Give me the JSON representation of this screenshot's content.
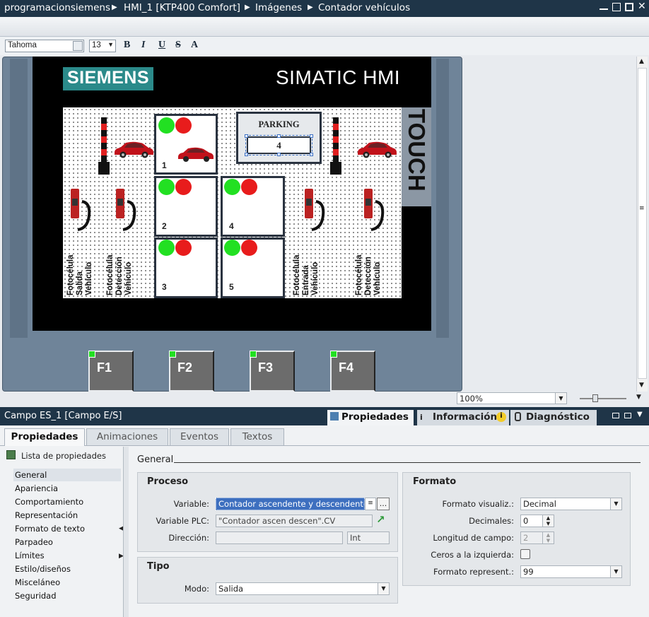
{
  "titlebar": {
    "crumbs": [
      "programacionsiemens",
      "HMI_1 [KTP400 Comfort]",
      "Imágenes",
      "Contador vehículos"
    ]
  },
  "toolbar": {
    "font": "Tahoma",
    "size": "13",
    "bold": "B",
    "italic": "I",
    "underline": "U",
    "strike": "S",
    "superscript": "A"
  },
  "hmi": {
    "brand": "SIEMENS",
    "product": "SIMATIC HMI",
    "touch": "TOUCH",
    "parking_title": "PARKING",
    "parking_value": "4",
    "spaces": [
      "1",
      "2",
      "4",
      "3",
      "5"
    ],
    "sensor_labels": [
      "Fotocélula Salida Vehículo",
      "Fotocélula Detección Vehículo",
      "Fotocélula Entrada Vehículo",
      "Fotocélula Detección Vehículo"
    ],
    "fkeys": [
      "F1",
      "F2",
      "F3",
      "F4"
    ],
    "colors": {
      "green": "#22e022",
      "red": "#e81c1c",
      "siemens": "#2b8a8a"
    }
  },
  "zoom": {
    "value": "100%"
  },
  "inspector": {
    "object": "Campo ES_1 [Campo E/S]",
    "header_tabs": [
      "Propiedades",
      "Información",
      "Diagnóstico"
    ],
    "tabs": [
      "Propiedades",
      "Animaciones",
      "Eventos",
      "Textos"
    ],
    "list_title": "Lista de propiedades",
    "nav": [
      "General",
      "Apariencia",
      "Comportamiento",
      "Representación",
      "Formato de texto",
      "Parpadeo",
      "Límites",
      "Estilo/diseños",
      "Misceláneo",
      "Seguridad"
    ],
    "section": "General",
    "proceso": {
      "title": "Proceso",
      "variable_label": "Variable:",
      "variable_value": "Contador ascendente y descendente",
      "plc_label": "Variable PLC:",
      "plc_value": "\"Contador ascen descen\".CV",
      "dir_label": "Dirección:",
      "dir_value": "",
      "type_value": "Int"
    },
    "tipo": {
      "title": "Tipo",
      "mode_label": "Modo:",
      "mode_value": "Salida"
    },
    "formato": {
      "title": "Formato",
      "visual_label": "Formato visualiz.:",
      "visual_value": "Decimal",
      "dec_label": "Decimales:",
      "dec_value": "0",
      "len_label": "Longitud de campo:",
      "len_value": "2",
      "zeros_label": "Ceros a la izquierda:",
      "rep_label": "Formato represent.:",
      "rep_value": "99"
    }
  }
}
